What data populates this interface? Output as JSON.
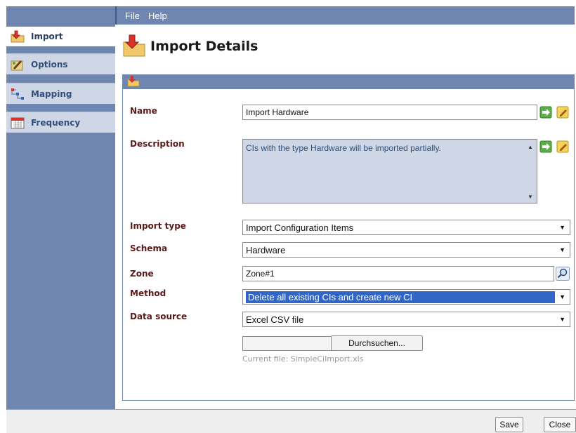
{
  "menu": {
    "file": "File",
    "help": "Help"
  },
  "sidebar": {
    "items": [
      {
        "label": "Import",
        "icon": "import-folder-icon",
        "active": true
      },
      {
        "label": "Options",
        "icon": "options-icon",
        "active": false
      },
      {
        "label": "Mapping",
        "icon": "mapping-icon",
        "active": false
      },
      {
        "label": "Frequency",
        "icon": "frequency-icon",
        "active": false
      }
    ]
  },
  "page": {
    "title": "Import Details"
  },
  "form": {
    "name": {
      "label": "Name",
      "value": "Import Hardware"
    },
    "description": {
      "label": "Description",
      "value": "CIs with the type Hardware will be imported partially."
    },
    "import_type": {
      "label": "Import type",
      "value": "Import Configuration Items"
    },
    "schema": {
      "label": "Schema",
      "value": "Hardware"
    },
    "zone": {
      "label": "Zone",
      "value": "Zone#1"
    },
    "method": {
      "label": "Method",
      "value": "Delete all existing CIs and create new CI"
    },
    "data_source": {
      "label": "Data source",
      "value": "Excel CSV file"
    },
    "browse_label": "Durchsuchen...",
    "current_file": "Current file: SimpleCiImport.xls"
  },
  "footer": {
    "save": "Save",
    "close": "Close"
  },
  "colors": {
    "sidebar_bg": "#6f86b0",
    "label_color": "#5a1a1a",
    "highlight": "#3166c7"
  }
}
